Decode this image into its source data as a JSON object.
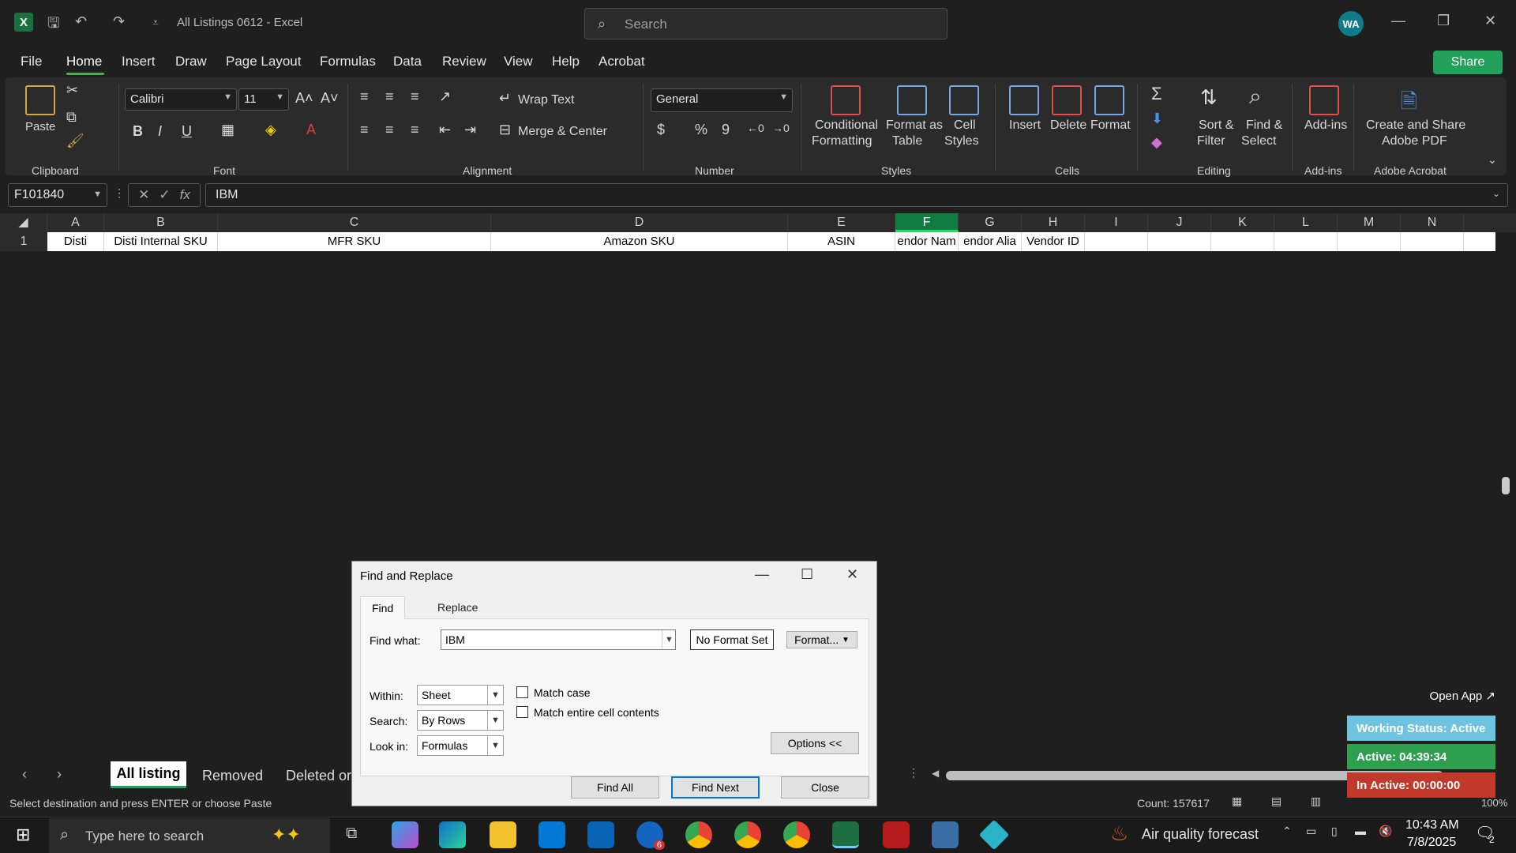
{
  "app": {
    "title": "All Listings 0612  -  Excel",
    "search_placeholder": "Search",
    "avatar_initials": "WA",
    "share_label": "Share"
  },
  "menu": [
    "File",
    "Home",
    "Insert",
    "Draw",
    "Page Layout",
    "Formulas",
    "Data",
    "Review",
    "View",
    "Help",
    "Acrobat"
  ],
  "ribbon": {
    "clipboard": {
      "paste": "Paste",
      "group": "Clipboard"
    },
    "font": {
      "name": "Calibri",
      "size": "11",
      "group": "Font",
      "bold": "B",
      "italic": "I",
      "underline": "U"
    },
    "alignment": {
      "wrap": "Wrap Text",
      "merge": "Merge & Center",
      "group": "Alignment"
    },
    "number": {
      "format": "General",
      "group": "Number",
      "currency": "$",
      "percent": "%",
      "comma": "9"
    },
    "styles": {
      "conditional": "Conditional",
      "conditional2": "Formatting",
      "format_table": "Format as",
      "format_table2": "Table",
      "cell_styles": "Cell",
      "cell_styles2": "Styles",
      "group": "Styles"
    },
    "cells": {
      "insert": "Insert",
      "delete": "Delete",
      "format": "Format",
      "group": "Cells"
    },
    "editing": {
      "sort": "Sort &",
      "sort2": "Filter",
      "find": "Find &",
      "find2": "Select",
      "group": "Editing"
    },
    "addins": {
      "label": "Add-ins",
      "group": "Add-ins"
    },
    "acrobat": {
      "label": "Create and Share",
      "label2": "Adobe PDF",
      "group": "Adobe Acrobat"
    }
  },
  "formula_bar": {
    "name_box": "F101840",
    "fx": "fx",
    "value": "IBM"
  },
  "columns": [
    "A",
    "B",
    "C",
    "D",
    "E",
    "F",
    "G",
    "H",
    "I",
    "J",
    "K",
    "L",
    "M",
    "N"
  ],
  "row1": {
    "num": "1",
    "cells": [
      "Disti",
      "Disti Internal SKU",
      "MFR SKU",
      "Amazon SKU",
      "ASIN",
      "endor Nam",
      "endor Alia",
      "Vendor ID",
      "",
      "",
      "",
      "",
      "",
      ""
    ]
  },
  "sheets": {
    "active": "All listing",
    "others": [
      "Removed",
      "Deleted or"
    ]
  },
  "status": {
    "message": "Select destination and press ENTER or choose Paste",
    "count": "Count: 157617",
    "zoom": "100%"
  },
  "dialog": {
    "title": "Find and Replace",
    "tabs": [
      "Find",
      "Replace"
    ],
    "find_label": "Find what:",
    "find_value": "IBM",
    "no_format": "No Format Set",
    "format_btn": "Format...",
    "within_label": "Within:",
    "within_value": "Sheet",
    "search_label": "Search:",
    "search_value": "By Rows",
    "lookin_label": "Look in:",
    "lookin_value": "Formulas",
    "match_case": "Match case",
    "match_entire": "Match entire cell contents",
    "options_btn": "Options <<",
    "find_all": "Find All",
    "find_next": "Find Next",
    "close": "Close"
  },
  "widget": {
    "open_app": "Open App ↗",
    "working": "Working Status: Active",
    "active": "Active: 04:39:34",
    "inactive": "In Active: 00:00:00",
    "colors": {
      "working": "#6fc3df",
      "active": "#2e9e4f",
      "inactive": "#c0392b"
    }
  },
  "taskbar": {
    "search_placeholder": "Type here to search",
    "weather": "Air quality forecast",
    "time": "10:43 AM",
    "date": "7/8/2025",
    "outlook_badge": "6",
    "notif_count": "2"
  }
}
